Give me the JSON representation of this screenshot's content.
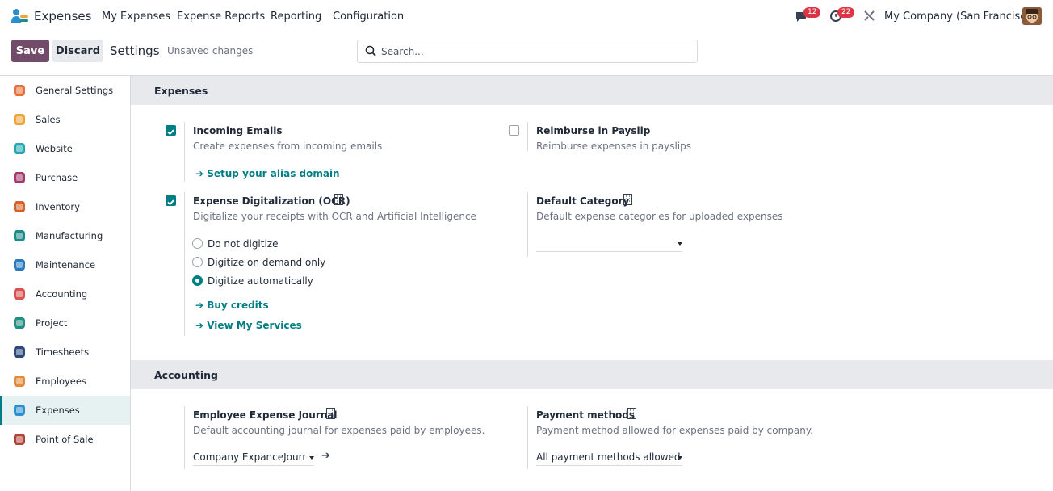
{
  "topbar": {
    "app_name": "Expenses",
    "menu": [
      "My Expenses",
      "Expense Reports",
      "Reporting",
      "Configuration"
    ],
    "messages_count": "12",
    "activities_count": "22",
    "company": "My Company (San Francisco)"
  },
  "controlbar": {
    "save_label": "Save",
    "discard_label": "Discard",
    "title": "Settings",
    "status": "Unsaved changes",
    "search_placeholder": "Search..."
  },
  "sidebar": {
    "items": [
      {
        "label": "General Settings",
        "icon": "general-settings-icon",
        "color": "#e86f3a"
      },
      {
        "label": "Sales",
        "icon": "sales-icon",
        "color": "#f0a33a"
      },
      {
        "label": "Website",
        "icon": "website-icon",
        "color": "#23a7b5"
      },
      {
        "label": "Purchase",
        "icon": "purchase-icon",
        "color": "#a3396b"
      },
      {
        "label": "Inventory",
        "icon": "inventory-icon",
        "color": "#d4622b"
      },
      {
        "label": "Manufacturing",
        "icon": "manufacturing-icon",
        "color": "#1a8a8a"
      },
      {
        "label": "Maintenance",
        "icon": "maintenance-icon",
        "color": "#2a7ac0"
      },
      {
        "label": "Accounting",
        "icon": "accounting-icon",
        "color": "#d9534f"
      },
      {
        "label": "Project",
        "icon": "project-icon",
        "color": "#1f8f85"
      },
      {
        "label": "Timesheets",
        "icon": "timesheets-icon",
        "color": "#2b4a7a"
      },
      {
        "label": "Employees",
        "icon": "employees-icon",
        "color": "#e08a3a"
      },
      {
        "label": "Expenses",
        "icon": "expenses-icon",
        "color": "#2a8fd0"
      },
      {
        "label": "Point of Sale",
        "icon": "point-of-sale-icon",
        "color": "#b0443a"
      }
    ],
    "active_index": 11
  },
  "expenses": {
    "heading": "Expenses",
    "incoming_emails": {
      "title": "Incoming Emails",
      "desc": "Create expenses from incoming emails",
      "checked": true,
      "link": "Setup your alias domain"
    },
    "reimburse_payslip": {
      "title": "Reimburse in Payslip",
      "desc": "Reimburse expenses in payslips",
      "checked": false
    },
    "ocr": {
      "title": "Expense Digitalization (OCR)",
      "desc": "Digitalize your receipts with OCR and Artificial Intelligence",
      "checked": true,
      "options": [
        "Do not digitize",
        "Digitize on demand only",
        "Digitize automatically"
      ],
      "selected": 2,
      "link_credits": "Buy credits",
      "link_services": "View My Services"
    },
    "default_category": {
      "title": "Default Category",
      "desc": "Default expense categories for uploaded expenses",
      "value": ""
    }
  },
  "accounting": {
    "heading": "Accounting",
    "journal": {
      "title": "Employee Expense Journal",
      "desc": "Default accounting journal for expenses paid by employees.",
      "value": "Company ExpanceJournal"
    },
    "payment": {
      "title": "Payment methods",
      "desc": "Payment method allowed for expenses paid by company.",
      "value": "All payment methods allowed"
    }
  },
  "colors": {
    "brand": "#714b67",
    "accent": "#017e84",
    "badge": "#dc3545"
  }
}
